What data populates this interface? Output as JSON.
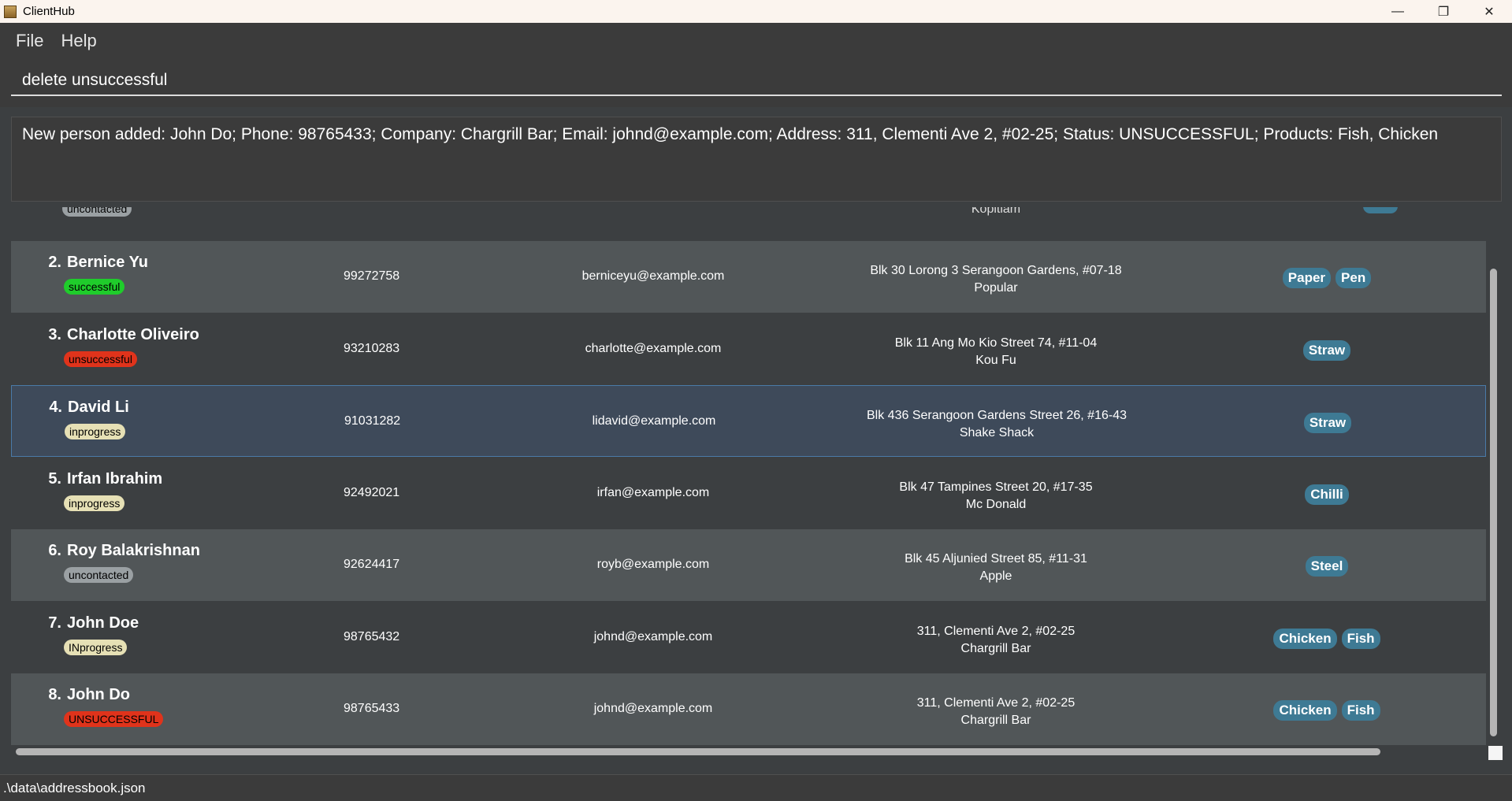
{
  "window": {
    "title": "ClientHub",
    "minimize": "—",
    "maximize": "❐",
    "close": "✕"
  },
  "menu": {
    "file": "File",
    "help": "Help"
  },
  "command": {
    "value": "delete unsuccessful"
  },
  "result": {
    "text": "New person added: John Do; Phone: 98765433; Company: Chargrill Bar; Email: johnd@example.com; Address: 311, Clementi Ave 2, #02-25; Status: UNSUCCESSFUL; Products: Fish, Chicken"
  },
  "partial_row": {
    "status": "uncontacted",
    "company": "Kopitiam"
  },
  "persons": [
    {
      "index": "2.",
      "name": "Bernice Yu",
      "status": "successful",
      "status_color": "#1fcc2b",
      "phone": "99272758",
      "email": "berniceyu@example.com",
      "address": "Blk 30 Lorong 3 Serangoon Gardens, #07-18",
      "company": "Popular",
      "products": [
        "Paper",
        "Pen"
      ]
    },
    {
      "index": "3.",
      "name": "Charlotte Oliveiro",
      "status": "unsuccessful",
      "status_color": "#e0331b",
      "phone": "93210283",
      "email": "charlotte@example.com",
      "address": "Blk 11 Ang Mo Kio Street 74, #11-04",
      "company": "Kou Fu",
      "products": [
        "Straw"
      ]
    },
    {
      "index": "4.",
      "name": "David Li",
      "status": "inprogress",
      "status_color": "#e6e0b5",
      "phone": "91031282",
      "email": "lidavid@example.com",
      "address": "Blk 436 Serangoon Gardens Street 26, #16-43",
      "company": "Shake Shack",
      "products": [
        "Straw"
      ]
    },
    {
      "index": "5.",
      "name": "Irfan Ibrahim",
      "status": "inprogress",
      "status_color": "#e6e0b5",
      "phone": "92492021",
      "email": "irfan@example.com",
      "address": "Blk 47 Tampines Street 20, #17-35",
      "company": "Mc Donald",
      "products": [
        "Chilli"
      ]
    },
    {
      "index": "6.",
      "name": "Roy Balakrishnan",
      "status": "uncontacted",
      "status_color": "#9aa0a3",
      "phone": "92624417",
      "email": "royb@example.com",
      "address": "Blk 45 Aljunied Street 85, #11-31",
      "company": "Apple",
      "products": [
        "Steel"
      ]
    },
    {
      "index": "7.",
      "name": "John Doe",
      "status": "INprogress",
      "status_color": "#e6e0b5",
      "phone": "98765432",
      "email": "johnd@example.com",
      "address": "311, Clementi Ave 2, #02-25",
      "company": "Chargrill Bar",
      "products": [
        "Chicken",
        "Fish"
      ]
    },
    {
      "index": "8.",
      "name": "John Do",
      "status": "UNSUCCESSFUL",
      "status_color": "#e0331b",
      "phone": "98765433",
      "email": "johnd@example.com",
      "address": "311, Clementi Ave 2, #02-25",
      "company": "Chargrill Bar",
      "products": [
        "Chicken",
        "Fish"
      ]
    }
  ],
  "selected_index": 2,
  "statusbar": {
    "path": ".\\data\\addressbook.json"
  }
}
